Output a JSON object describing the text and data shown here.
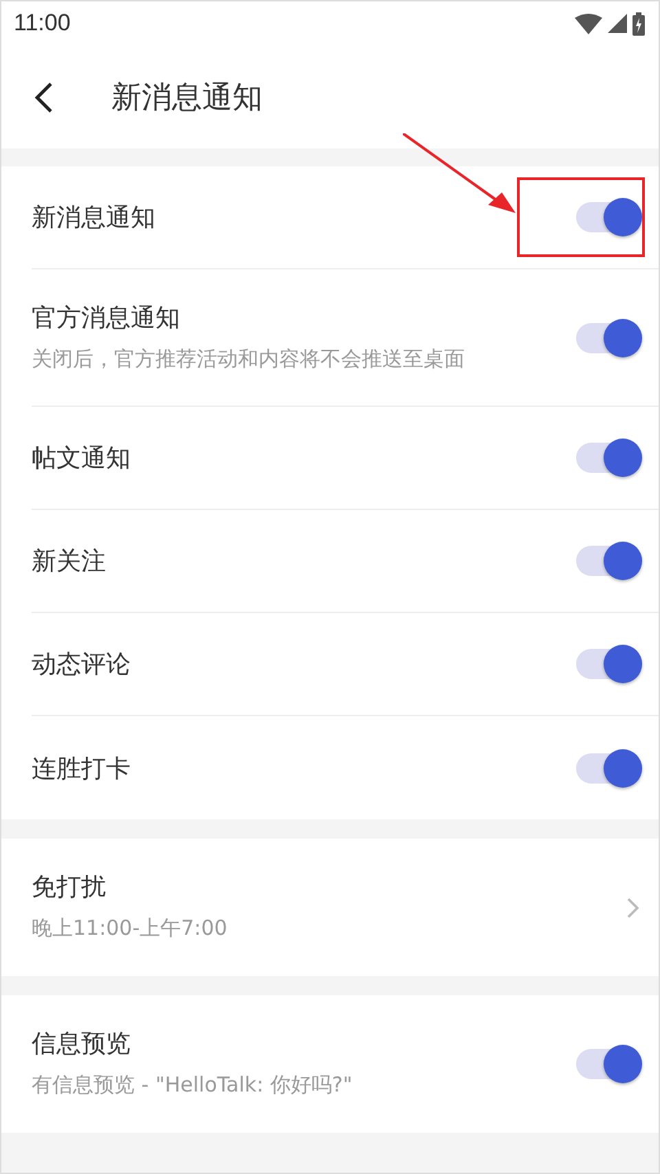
{
  "status_bar": {
    "time": "11:00"
  },
  "header": {
    "title": "新消息通知"
  },
  "sections": [
    {
      "items": [
        {
          "kind": "toggle",
          "label": "新消息通知",
          "on": true
        },
        {
          "kind": "toggle",
          "label": "官方消息通知",
          "description": "关闭后，官方推荐活动和内容将不会推送至桌面",
          "on": true
        },
        {
          "kind": "toggle",
          "label": "帖文通知",
          "on": true
        },
        {
          "kind": "toggle",
          "label": "新关注",
          "on": true
        },
        {
          "kind": "toggle",
          "label": "动态评论",
          "on": true
        },
        {
          "kind": "toggle",
          "label": "连胜打卡",
          "on": true
        }
      ]
    },
    {
      "items": [
        {
          "kind": "link",
          "label": "免打扰",
          "description": "晚上11:00-上午7:00"
        }
      ]
    },
    {
      "items": [
        {
          "kind": "toggle",
          "label": "信息预览",
          "description": "有信息预览 - \"HelloTalk: 你好吗?\"",
          "on": true
        }
      ]
    }
  ]
}
